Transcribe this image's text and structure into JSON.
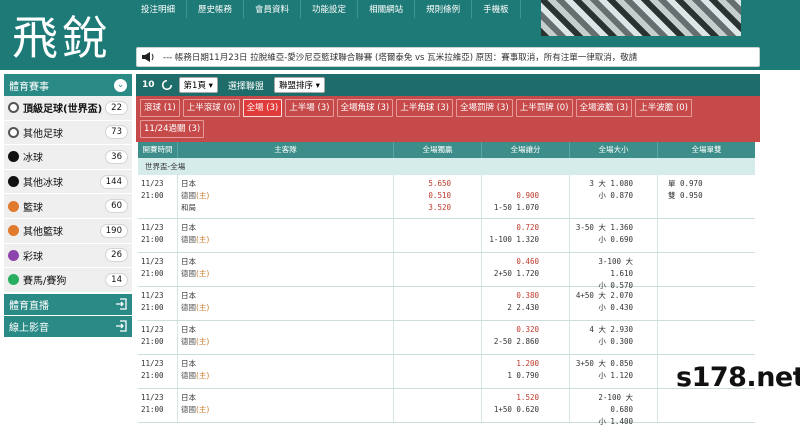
{
  "brand": {
    "logo_text": "飛銳",
    "watermark": "s178.net"
  },
  "topnav": [
    "投注明細",
    "歷史帳務",
    "會員資料",
    "功能設定",
    "相關網站",
    "規則條例",
    "手機板"
  ],
  "marquee": {
    "text": "--- 帳務日期11月23日 拉脫維亞-愛沙尼亞籃球聯合聯賽 (塔爾泰免 vs 瓦米拉維亞) 原因：賽事取消，所有注單一律取消，敬請"
  },
  "sidebar": {
    "header": "體育賽事",
    "items": [
      {
        "label": "頂級足球(世界盃)",
        "count": "22",
        "icon": "soccer-ball-icon",
        "bold": true
      },
      {
        "label": "其他足球",
        "count": "73",
        "icon": "soccer-ball-icon"
      },
      {
        "label": "冰球",
        "count": "36",
        "icon": "hockey-puck-icon"
      },
      {
        "label": "其他冰球",
        "count": "144",
        "icon": "hockey-puck-icon"
      },
      {
        "label": "籃球",
        "count": "60",
        "icon": "basketball-icon"
      },
      {
        "label": "其他籃球",
        "count": "190",
        "icon": "basketball-icon"
      },
      {
        "label": "彩球",
        "count": "26",
        "icon": "lottery-ball-icon"
      },
      {
        "label": "賽馬/賽狗",
        "count": "14",
        "icon": "racing-icon"
      }
    ],
    "links": [
      {
        "label": "體育直播",
        "icon": "login-icon"
      },
      {
        "label": "線上影音",
        "icon": "login-icon"
      }
    ]
  },
  "toolbar": {
    "count": "10",
    "page": "第1頁",
    "select_league": "選擇聯盟",
    "sort": "聯盟排序"
  },
  "tabs": [
    {
      "label": "滾球 (1)"
    },
    {
      "label": "上半滾球 (0)"
    },
    {
      "label": "全場 (3)",
      "active": true
    },
    {
      "label": "上半場 (3)"
    },
    {
      "label": "全場角球 (3)"
    },
    {
      "label": "上半角球 (3)"
    },
    {
      "label": "全場罰牌 (3)"
    },
    {
      "label": "上半罰牌 (0)"
    },
    {
      "label": "全場波膽 (3)"
    },
    {
      "label": "上半波膽 (0)"
    },
    {
      "label": "11/24過關 (3)"
    }
  ],
  "columns": [
    "開賽時間",
    "主客隊",
    "全場獨贏",
    "全場讓分",
    "全場大小",
    "全場單雙"
  ],
  "league": "世界盃-全場",
  "matches": [
    {
      "date": "11/23",
      "time": "21:00",
      "team1": "日本",
      "team2": "德國",
      "tag": "(主)",
      "draw": "和局",
      "odds_1x2": [
        "5.650",
        "0.510",
        "3.520"
      ],
      "hdp": [
        "",
        "0.900"
      ],
      "hdp_line": [
        "",
        "1-50 1.070"
      ],
      "ou": [
        "3 大 1.080",
        "小 0.870"
      ],
      "oe": [
        "單 0.970",
        "雙 0.950"
      ]
    },
    {
      "date": "11/23",
      "time": "21:00",
      "team1": "日本",
      "team2": "德國",
      "tag": "(主)",
      "hdp": [
        "0.720",
        "1-100 1.320"
      ],
      "ou": [
        "3-50 大 1.360",
        "小 0.690"
      ]
    },
    {
      "date": "11/23",
      "time": "21:00",
      "team1": "日本",
      "team2": "德國",
      "tag": "(主)",
      "hdp": [
        "0.460",
        "2+50 1.720"
      ],
      "ou": [
        "3-100 大 1.610",
        "小 0.570"
      ]
    },
    {
      "date": "11/23",
      "time": "21:00",
      "team1": "日本",
      "team2": "德國",
      "tag": "(主)",
      "hdp": [
        "0.380",
        "2 2.430"
      ],
      "ou": [
        "4+50 大 2.070",
        "小 0.430"
      ]
    },
    {
      "date": "11/23",
      "time": "21:00",
      "team1": "日本",
      "team2": "德國",
      "tag": "(主)",
      "hdp": [
        "0.320",
        "2-50 2.860"
      ],
      "ou": [
        "4 大 2.930",
        "小 0.300"
      ]
    },
    {
      "date": "11/23",
      "time": "21:00",
      "team1": "日本",
      "team2": "德國",
      "tag": "(主)",
      "hdp": [
        "1.200",
        "1 0.790"
      ],
      "ou": [
        "3+50 大 0.850",
        "小 1.120"
      ]
    },
    {
      "date": "11/23",
      "time": "21:00",
      "team1": "日本",
      "team2": "德國",
      "tag": "(主)",
      "hdp": [
        "1.520",
        "1+50 0.620"
      ],
      "ou": [
        "2-100 大 0.680",
        "小 1.400"
      ]
    }
  ]
}
